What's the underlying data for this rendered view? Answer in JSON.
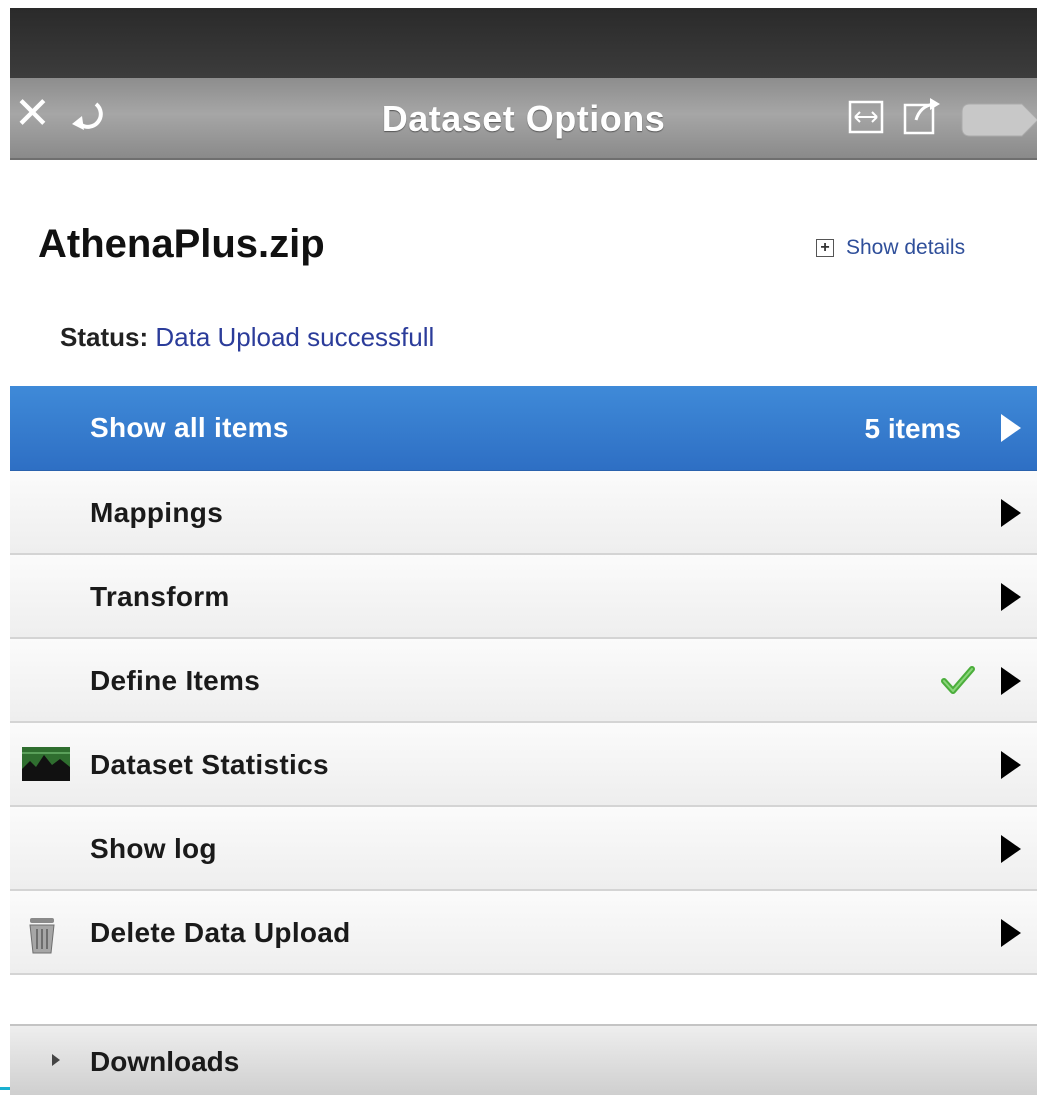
{
  "header": {
    "title": "Dataset Options",
    "icons": [
      "close-icon",
      "undo-icon",
      "expand-icon",
      "export-icon",
      "tag-icon"
    ]
  },
  "dataset": {
    "name": "AthenaPlus.zip",
    "show_details": "Show details",
    "status_label": "Status:",
    "status_value": "Data Upload successfull"
  },
  "menu": {
    "items": [
      {
        "label": "Show all items",
        "count": "5 items",
        "active": true
      },
      {
        "label": "Mappings"
      },
      {
        "label": "Transform"
      },
      {
        "label": "Define Items",
        "checked": true
      },
      {
        "label": "Dataset Statistics",
        "icon": "chart-icon"
      },
      {
        "label": "Show log"
      },
      {
        "label": "Delete Data Upload",
        "icon": "trash-icon"
      }
    ]
  },
  "downloads": {
    "label": "Downloads"
  },
  "colors": {
    "active_row": "#2e6fc4",
    "status_text": "#2b3c9a",
    "check": "#4cae3c"
  }
}
